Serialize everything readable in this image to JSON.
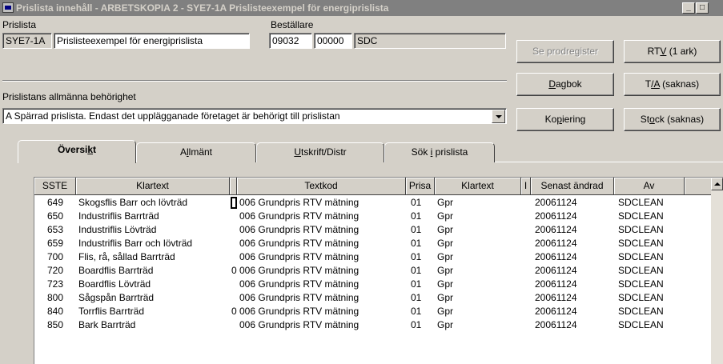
{
  "window": {
    "title": "Prislista innehåll - ARBETSKOPIA 2  - SYE7-1A Prislisteexempel för energiprislista",
    "min_label": "_",
    "max_label": "□"
  },
  "header": {
    "prislista_label": "Prislista",
    "prislista_code": "SYE7-1A",
    "prislista_name": "Prislisteexempel för energiprislista",
    "bestallare_label": "Beställare",
    "bestallare_1": "09032",
    "bestallare_2": "00000",
    "bestallare_3": "SDC"
  },
  "behorighet": {
    "label": "Prislistans allmänna behörighet",
    "value": "A Spärrad prislista. Endast det upplägganade företaget är behörigt till prislistan"
  },
  "buttons": {
    "prodregister": "Se prodregister",
    "rtv_pre": "RT",
    "rtv_ul": "V",
    "rtv_post": " (1 ark)",
    "dagbok_ul": "D",
    "dagbok_post": "agbok",
    "ta_pre": "T",
    "ta_ul": "/A",
    "ta_post": " (saknas)",
    "kopiering_pre": "Ko",
    "kopiering_ul": "p",
    "kopiering_post": "iering",
    "stock_pre": "St",
    "stock_ul": "o",
    "stock_post": "ck (saknas)"
  },
  "tabs": {
    "oversikt_pre": "Översi",
    "oversikt_ul": "k",
    "oversikt_post": "t",
    "allmant_pre": "A",
    "allmant_ul": "l",
    "allmant_post": "lmänt",
    "utskrift_ul": "U",
    "utskrift_post": "tskrift/Distr",
    "sok_pre": "Sök ",
    "sok_ul": "i",
    "sok_post": " prislista"
  },
  "table": {
    "columns": [
      "SSTE",
      "Klartext",
      "",
      "Textkod",
      "Prisa",
      "Klartext",
      "I",
      "Senast ändrad",
      "Av"
    ],
    "rows": [
      {
        "sste": "649",
        "klartext": "Skogsflis Barr och lövträd",
        "flag": "",
        "textkod": "006 Grundpris RTV mätning",
        "prisa": "01",
        "klartext2": "Gpr",
        "datum": "20061124",
        "av": "SDCLEAN"
      },
      {
        "sste": "650",
        "klartext": "Industriflis Barrträd",
        "flag": "",
        "textkod": "006 Grundpris RTV mätning",
        "prisa": "01",
        "klartext2": "Gpr",
        "datum": "20061124",
        "av": "SDCLEAN"
      },
      {
        "sste": "653",
        "klartext": "Industriflis Lövträd",
        "flag": "",
        "textkod": "006 Grundpris RTV mätning",
        "prisa": "01",
        "klartext2": "Gpr",
        "datum": "20061124",
        "av": "SDCLEAN"
      },
      {
        "sste": "659",
        "klartext": "Industriflis Barr och lövträd",
        "flag": "",
        "textkod": "006 Grundpris RTV mätning",
        "prisa": "01",
        "klartext2": "Gpr",
        "datum": "20061124",
        "av": "SDCLEAN"
      },
      {
        "sste": "700",
        "klartext": "Flis, rå, sållad Barrträd",
        "flag": "",
        "textkod": "006 Grundpris RTV mätning",
        "prisa": "01",
        "klartext2": "Gpr",
        "datum": "20061124",
        "av": "SDCLEAN"
      },
      {
        "sste": "720",
        "klartext": "Boardflis Barrträd",
        "flag": "0",
        "textkod": "006 Grundpris RTV mätning",
        "prisa": "01",
        "klartext2": "Gpr",
        "datum": "20061124",
        "av": "SDCLEAN"
      },
      {
        "sste": "723",
        "klartext": "Boardflis Lövträd",
        "flag": "",
        "textkod": "006 Grundpris RTV mätning",
        "prisa": "01",
        "klartext2": "Gpr",
        "datum": "20061124",
        "av": "SDCLEAN"
      },
      {
        "sste": "800",
        "klartext": "Sågspån Barrträd",
        "flag": "",
        "textkod": "006 Grundpris RTV mätning",
        "prisa": "01",
        "klartext2": "Gpr",
        "datum": "20061124",
        "av": "SDCLEAN"
      },
      {
        "sste": "840",
        "klartext": "Torrflis Barrträd",
        "flag": "0",
        "textkod": "006 Grundpris RTV mätning",
        "prisa": "01",
        "klartext2": "Gpr",
        "datum": "20061124",
        "av": "SDCLEAN"
      },
      {
        "sste": "850",
        "klartext": "Bark Barrträd",
        "flag": "",
        "textkod": "006 Grundpris RTV mätning",
        "prisa": "01",
        "klartext2": "Gpr",
        "datum": "20061124",
        "av": "SDCLEAN"
      }
    ]
  }
}
